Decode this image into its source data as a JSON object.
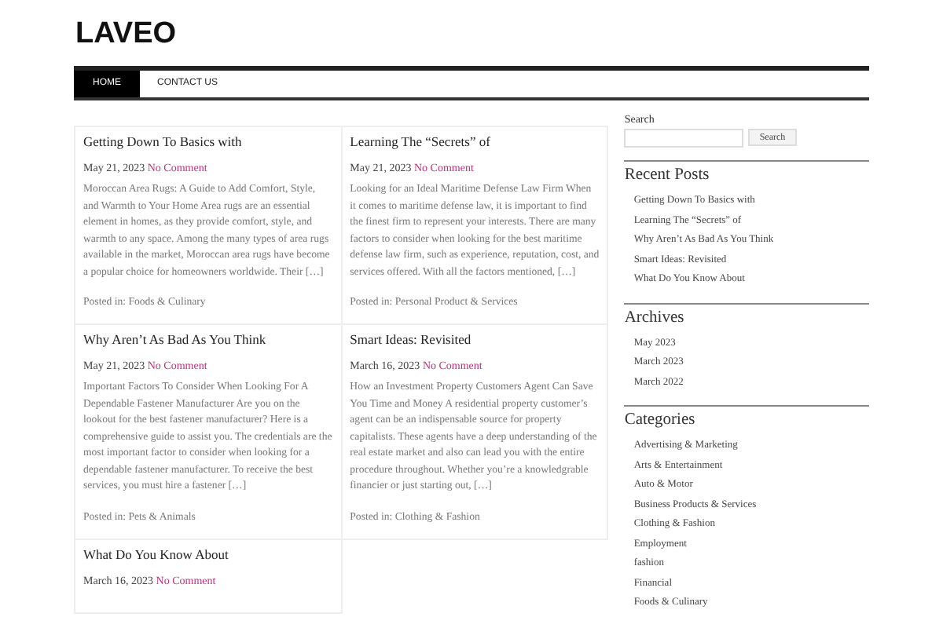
{
  "site_title": "LAVEO",
  "nav": [
    {
      "label": "HOME",
      "selected": true
    },
    {
      "label": "CONTACT US",
      "selected": false
    }
  ],
  "posts": [
    {
      "title": "Getting Down To Basics with",
      "date": "May 21, 2023",
      "comments": "No Comment",
      "excerpt": "Moroccan Area Rugs: A Guide to Add Comfort, Style, and Warmth to Your Home Area rugs are an essential element in homes, as they provide comfort, style, and warmth to any space. Among the many types of area rugs available in the market, Moroccan area rugs have become a popular choice for homeowners worldwide. Their […]",
      "category": "Posted in: Foods & Culinary"
    },
    {
      "title": "Learning The “Secrets” of",
      "date": "May 21, 2023",
      "comments": "No Comment",
      "excerpt": "Looking for an Ideal Maritime Defense Law Firm When it comes to maritime defense law, it is important to find the finest firm to represent your interests. There are many factors to consider when looking for the best maritime defense law firm, such as experience, reputation, cost, and services offered. With all the factors mentioned, […]",
      "category": "Posted in: Personal Product & Services"
    },
    {
      "title": "Why Aren’t As Bad As You Think",
      "date": "May 21, 2023",
      "comments": "No Comment",
      "excerpt": "Important Factors To Consider When Looking For A Dependable Fastener Manufacturer Are you on the lookout for the best fastener manufacturer? Here is a comprehensive guide to assist you. The credentials are the most important factor to consider when looking for a dependable fastener manufacturer. To receive the best services, you must hire a fastener […]",
      "category": "Posted in: Pets & Animals"
    },
    {
      "title": "Smart Ideas: Revisited",
      "date": "March 16, 2023",
      "comments": "No Comment",
      "excerpt": "How an Investment Property Customers Agent Can Save You Time and Money A residential property customer’s agent can be an indispensable source for property capitalists. These agents have a deep understanding of the real estate market and also can lead you with the entire procedure throughout. Whether you’re a knowledgrable financier or just starting out, […]",
      "category": "Posted in: Clothing & Fashion"
    },
    {
      "title": "What Do You Know About",
      "date": "March 16, 2023",
      "comments": "No Comment"
    }
  ],
  "sidebar": {
    "search_label": "Search",
    "search_button": "Search",
    "widgets": [
      {
        "title": "Recent Posts",
        "items": [
          "Getting Down To Basics with",
          "Learning The “Secrets” of",
          "Why Aren’t As Bad As You Think",
          "Smart Ideas: Revisited",
          "What Do You Know About"
        ]
      },
      {
        "title": "Archives",
        "items": [
          "May 2023",
          "March 2023",
          "March 2022"
        ]
      },
      {
        "title": "Categories",
        "items": [
          "Advertising & Marketing",
          "Arts & Entertainment",
          "Auto & Motor",
          "Business Products & Services",
          "Clothing & Fashion",
          "Employment",
          "fashion",
          "Financial",
          "Foods & Culinary"
        ]
      }
    ]
  }
}
